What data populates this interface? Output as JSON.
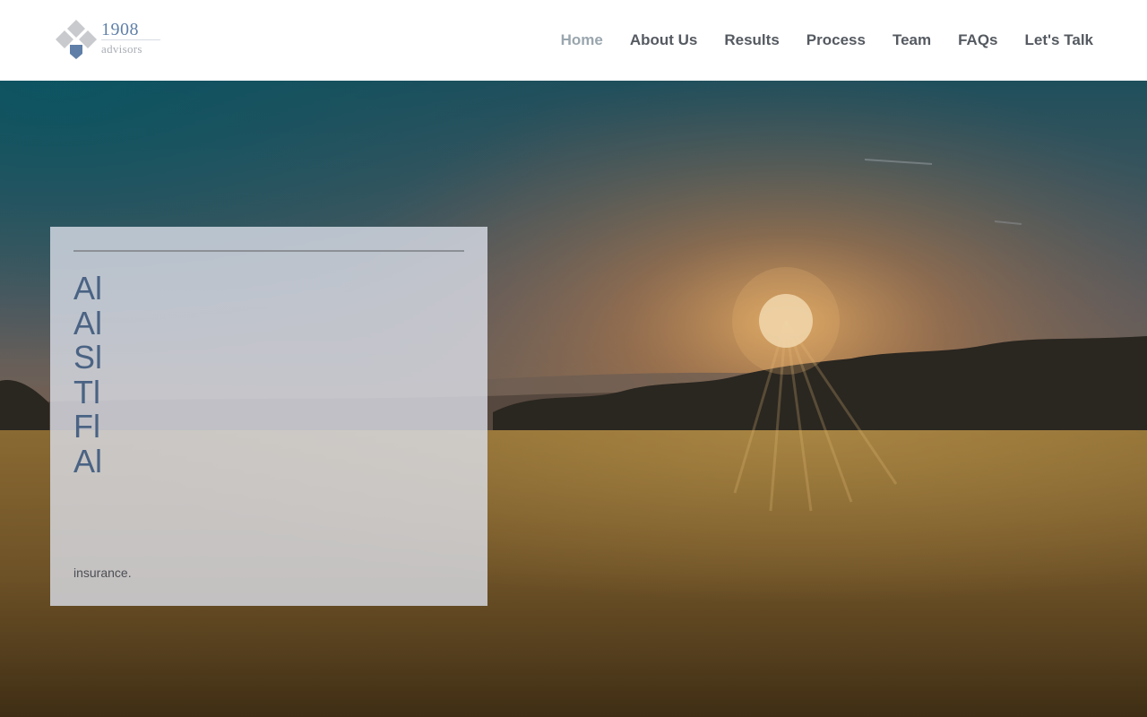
{
  "brand": {
    "year": "1908",
    "subtitle": "advisors",
    "logo_icon": "diamond-cluster-icon",
    "colors": {
      "accent": "#5f7fa8",
      "gray": "#c8cacd"
    }
  },
  "nav": {
    "items": [
      {
        "label": "Home",
        "active": true
      },
      {
        "label": "About Us",
        "active": false
      },
      {
        "label": "Results",
        "active": false
      },
      {
        "label": "Process",
        "active": false
      },
      {
        "label": "Team",
        "active": false
      },
      {
        "label": "FAQs",
        "active": false
      },
      {
        "label": "Let's Talk",
        "active": false
      }
    ]
  },
  "hero": {
    "card": {
      "lines": [
        "Al",
        "Al",
        "Sl",
        "Tl",
        "Fl",
        "Al"
      ],
      "footer": "insurance."
    }
  }
}
